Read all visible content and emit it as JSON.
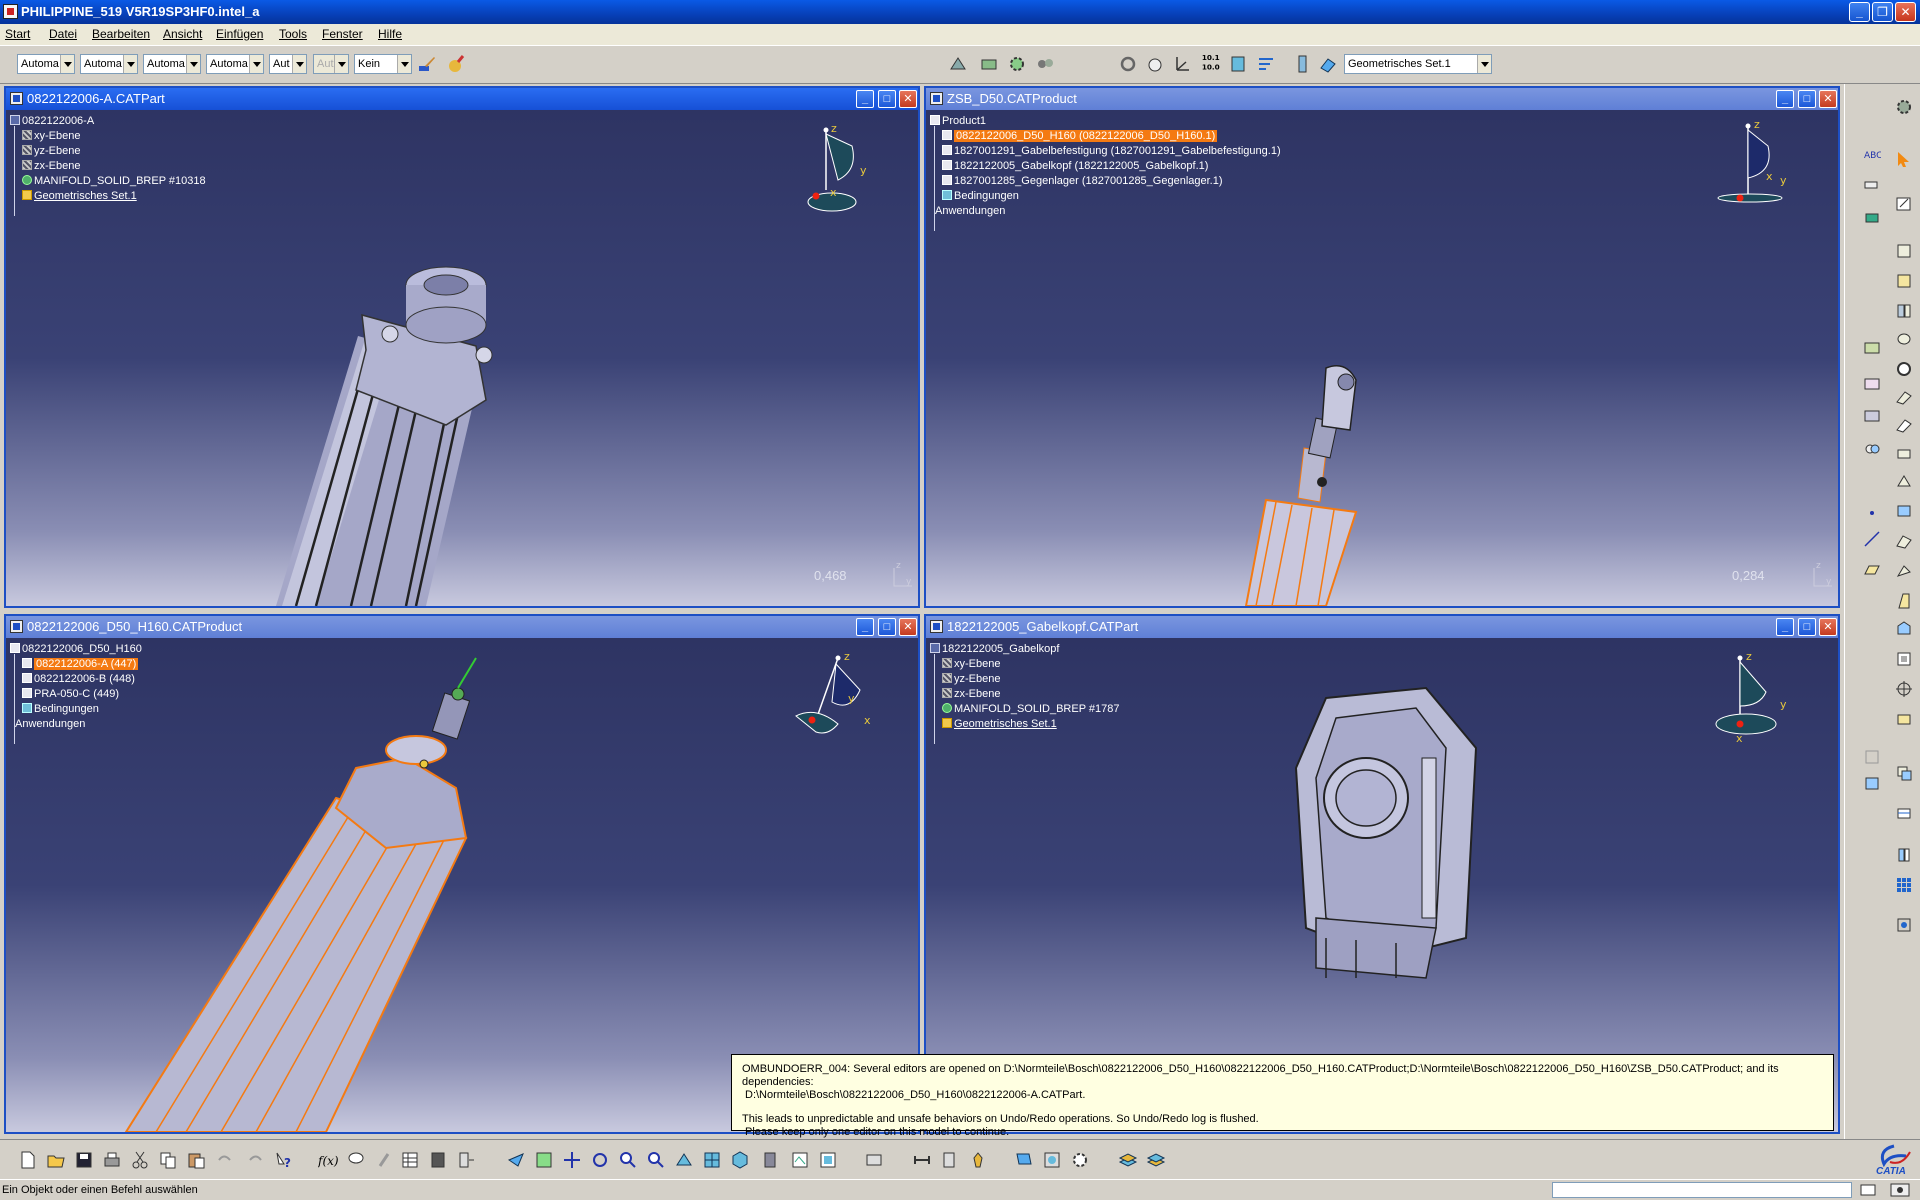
{
  "app": {
    "title": "PHILIPPINE_519   V5R19SP3HF0.intel_a"
  },
  "menu": [
    "Start",
    "Datei",
    "Bearbeiten",
    "Ansicht",
    "Einfügen",
    "Tools",
    "Fenster",
    "Hilfe"
  ],
  "toolbar": {
    "combos": [
      "Automa",
      "Automa",
      "Automa",
      "Automa",
      "Aut",
      "Aut",
      "Kein"
    ],
    "geom_set": "Geometrisches Set.1"
  },
  "windows": [
    {
      "title": "0822122006-A.CATPart",
      "scale": "0,468",
      "tree": [
        {
          "label": "0822122006-A",
          "icon": "part-icon"
        },
        {
          "label": "xy-Ebene",
          "icon": "plane-icon"
        },
        {
          "label": "yz-Ebene",
          "icon": "plane-icon"
        },
        {
          "label": "zx-Ebene",
          "icon": "plane-icon"
        },
        {
          "label": "MANIFOLD_SOLID_BREP #10318",
          "icon": "solid-icon"
        },
        {
          "label": "Geometrisches Set.1",
          "icon": "geometrical-set-icon"
        }
      ]
    },
    {
      "title": "ZSB_D50.CATProduct",
      "scale": "0,284",
      "tree": [
        {
          "label": "Product1",
          "icon": "product-icon"
        },
        {
          "label": "0822122006_D50_H160 (0822122006_D50_H160.1)",
          "icon": "component-icon"
        },
        {
          "label": "1827001291_Gabelbefestigung (1827001291_Gabelbefestigung.1)",
          "icon": "component-icon"
        },
        {
          "label": "1822122005_Gabelkopf (1822122005_Gabelkopf.1)",
          "icon": "component-icon"
        },
        {
          "label": "1827001285_Gegenlager (1827001285_Gegenlager.1)",
          "icon": "component-icon"
        },
        {
          "label": "Bedingungen",
          "icon": "constraints-icon"
        },
        {
          "label": "Anwendungen",
          "icon": ""
        }
      ]
    },
    {
      "title": "0822122006_D50_H160.CATProduct",
      "tree": [
        {
          "label": "0822122006_D50_H160",
          "icon": "product-icon"
        },
        {
          "label": "0822122006-A (447)",
          "icon": "component-icon"
        },
        {
          "label": "0822122006-B (448)",
          "icon": "component-icon"
        },
        {
          "label": "PRA-050-C (449)",
          "icon": "component-icon"
        },
        {
          "label": "Bedingungen",
          "icon": "constraints-icon"
        },
        {
          "label": "Anwendungen",
          "icon": ""
        }
      ]
    },
    {
      "title": "1822122005_Gabelkopf.CATPart",
      "tree": [
        {
          "label": "1822122005_Gabelkopf",
          "icon": "part-icon"
        },
        {
          "label": "xy-Ebene",
          "icon": "plane-icon"
        },
        {
          "label": "yz-Ebene",
          "icon": "plane-icon"
        },
        {
          "label": "zx-Ebene",
          "icon": "plane-icon"
        },
        {
          "label": "MANIFOLD_SOLID_BREP #1787",
          "icon": "solid-icon"
        },
        {
          "label": "Geometrisches Set.1",
          "icon": "geometrical-set-icon"
        }
      ]
    }
  ],
  "compass": {
    "x": "x",
    "y": "y",
    "z": "z"
  },
  "message": {
    "line1": "OMBUNDOERR_004: Several editors are opened on D:\\Normteile\\Bosch\\0822122006_D50_H160\\0822122006_D50_H160.CATProduct;D:\\Normteile\\Bosch\\0822122006_D50_H160\\ZSB_D50.CATProduct; and its dependencies:",
    "line2": "D:\\Normteile\\Bosch\\0822122006_D50_H160\\0822122006-A.CATPart.",
    "line3": "This leads to unpredictable and unsafe behaviors on Undo/Redo operations. So Undo/Redo log is flushed.",
    "line4": "Please keep only one editor on this model to continue."
  },
  "status": {
    "prompt": "Ein Objekt oder einen Befehl auswählen",
    "brand": "CATIA"
  },
  "colors": {
    "accent": "#f47a12",
    "viewport_top": "#2e3463",
    "titlebar": "#0a5ae6"
  }
}
